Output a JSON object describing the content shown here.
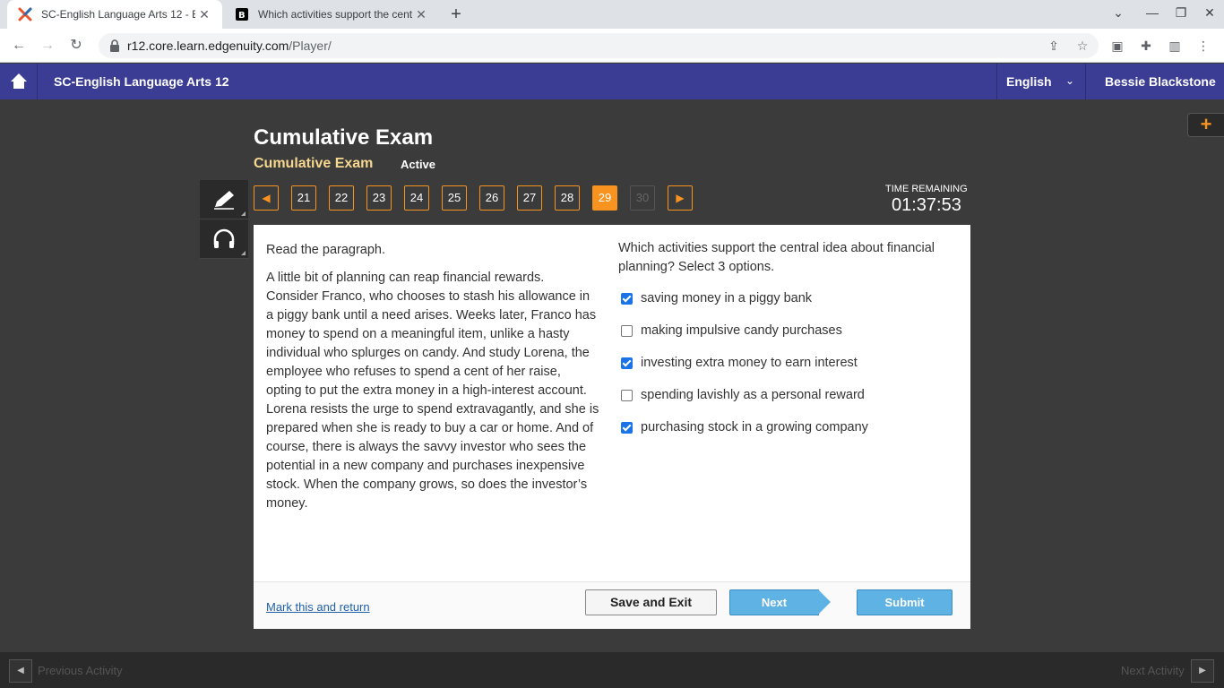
{
  "browser": {
    "tabs": [
      {
        "title": "SC-English Language Arts 12 - E",
        "active": true
      },
      {
        "title": "Which activities support the cent",
        "active": false
      }
    ],
    "url_host": "r12.core.learn.edgenuity.com",
    "url_path": "/Player/"
  },
  "app": {
    "course_title": "SC-English Language Arts 12",
    "language": "English",
    "user_name": "Bessie Blackstone",
    "accent_color": "#3b3c93"
  },
  "exam": {
    "title": "Cumulative Exam",
    "subtitle": "Cumulative Exam",
    "status": "Active",
    "questions": [
      "21",
      "22",
      "23",
      "24",
      "25",
      "26",
      "27",
      "28",
      "29",
      "30"
    ],
    "current_question": "29",
    "time_label": "TIME REMAINING",
    "time_value": "01:37:53"
  },
  "passage": {
    "instruction": "Read the paragraph.",
    "text": "A little bit of planning can reap financial rewards. Consider Franco, who chooses to stash his allowance in a piggy bank until a need arises. Weeks later, Franco has money to spend on a meaningful item, unlike a hasty individual who splurges on candy. And study Lorena, the employee who refuses to spend a cent of her raise, opting to put the extra money in a high-interest account. Lorena resists the urge to spend extravagantly, and she is prepared when she is ready to buy a car or home. And of course, there is always the savvy investor who sees the potential in a new company and purchases inexpensive stock. When the company grows, so does the investor’s money."
  },
  "question": {
    "prompt": "Which activities support the central idea about financial planning? Select 3 options.",
    "options": [
      {
        "label": "saving money in a piggy bank",
        "checked": true
      },
      {
        "label": "making impulsive candy purchases",
        "checked": false
      },
      {
        "label": "investing extra money to earn interest",
        "checked": true
      },
      {
        "label": "spending lavishly as a personal reward",
        "checked": false
      },
      {
        "label": "purchasing stock in a growing company",
        "checked": true
      }
    ]
  },
  "footer": {
    "mark_link": "Mark this and return",
    "save_exit": "Save and Exit",
    "next": "Next",
    "submit": "Submit"
  },
  "bottom": {
    "prev_activity": "Previous Activity",
    "next_activity": "Next Activity"
  }
}
